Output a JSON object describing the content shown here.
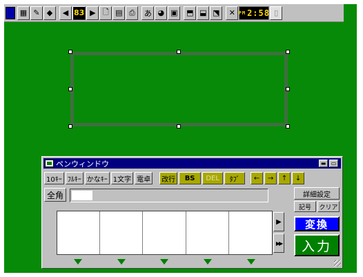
{
  "toolbar": {
    "glyphs": {
      "app": "▦",
      "pen": "✎",
      "diamond": "◆",
      "prev": "◀",
      "page": "83",
      "next": "▶",
      "new": "🗋",
      "form": "▤",
      "print": "⎙",
      "kana": "あ",
      "tool1": "◕",
      "tool2": "▣",
      "tool3": "⬒",
      "tool4": "⬓",
      "tool5": "⬔",
      "close": "✕",
      "scroll": "▯"
    },
    "clock_ampm": "PM",
    "clock_time": "2:58"
  },
  "pen_window": {
    "title": "ペンウィンドウ",
    "min_glyph": "▬",
    "max_glyph": "▭",
    "keys": [
      "10ｷｰ",
      "ﾌﾙｷｰ",
      "かなｷｰ",
      "1文字",
      "電卓"
    ],
    "edit_keys": [
      "改行",
      "BS",
      "DEL",
      "ﾀﾌﾞ"
    ],
    "arrow_keys": [
      "←",
      "→",
      "↑",
      "↓"
    ],
    "zenkaku": "全角",
    "detail_settings": "詳細設定",
    "symbol": "記号",
    "clear": "クリア",
    "convert": "変換",
    "enter": "入力",
    "scroll_right": "▶",
    "scroll_end": "▶▶"
  },
  "colors": {
    "desktop": "#078a07",
    "titlebar": "#000080",
    "convert_button": "#0000ff",
    "enter_button": "#008000",
    "edit_key_bg": "#a8a800"
  }
}
